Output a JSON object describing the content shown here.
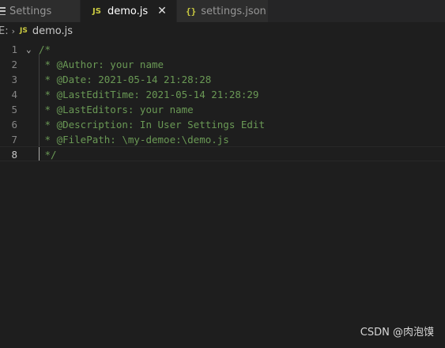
{
  "tabs": [
    {
      "label": "Settings",
      "icon": "menu-icon"
    },
    {
      "label": "demo.js",
      "icon": "js-icon",
      "badge": "JS",
      "close": "✕"
    },
    {
      "label": "settings.json",
      "icon": "json-icon",
      "badge": "{}"
    }
  ],
  "breadcrumb": {
    "fragment": "E:",
    "chevron": "›",
    "badge": "JS",
    "file": "demo.js"
  },
  "editor": {
    "lines": [
      {
        "number": "1",
        "text": "/*",
        "fold": "⌄"
      },
      {
        "number": "2",
        "text": " * @Author: your name"
      },
      {
        "number": "3",
        "text": " * @Date: 2021-05-14 21:28:28"
      },
      {
        "number": "4",
        "text": " * @LastEditTime: 2021-05-14 21:28:29"
      },
      {
        "number": "5",
        "text": " * @LastEditors: your name"
      },
      {
        "number": "6",
        "text": " * @Description: In User Settings Edit"
      },
      {
        "number": "7",
        "text": " * @FilePath: \\my-demoe:\\demo.js"
      },
      {
        "number": "8",
        "text": " */"
      }
    ],
    "current_line": "8"
  },
  "watermark": "CSDN @肉泡馍",
  "colors": {
    "background": "#1e1e1e",
    "comment": "#6a9955",
    "js_badge": "#cbcb41"
  }
}
